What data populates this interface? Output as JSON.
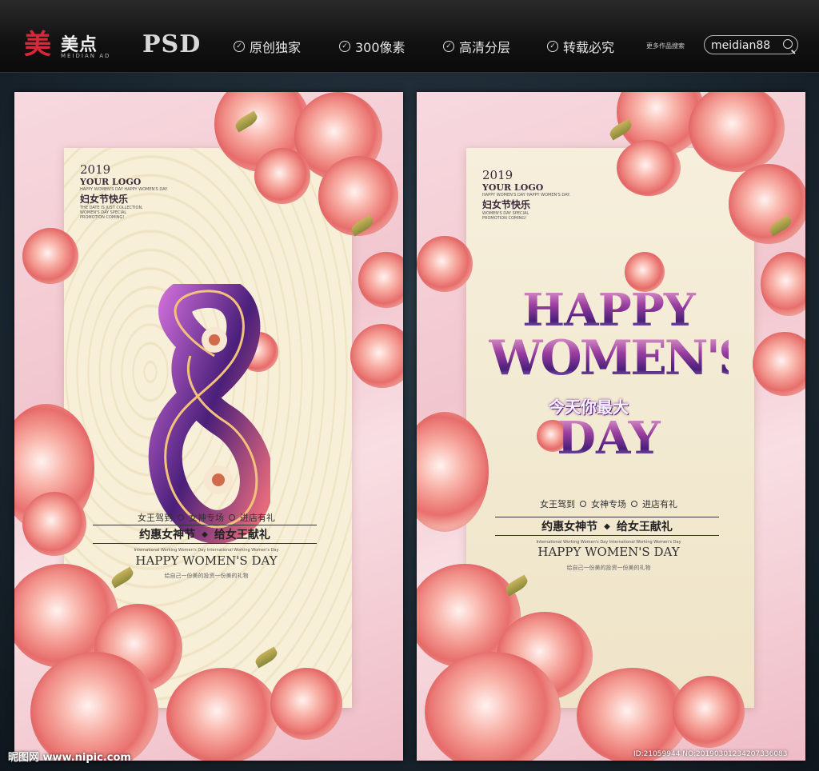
{
  "header": {
    "logo_mark": "美",
    "logo_text": "美点",
    "logo_sub": "MEIDIAN AD",
    "format": "PSD",
    "features": [
      "原创独家",
      "300像素",
      "高清分层",
      "转载必究"
    ],
    "more_label": "更多作品搜索",
    "search_value": "meidian88"
  },
  "poster_left": {
    "year": "2019",
    "logo": "YOUR LOGO",
    "tiny_en": "HAPPY WOMEN'S DAY HAPPY WOMEN'S DAY.",
    "title_cn": "妇女节快乐",
    "tiny_en2": "THE DATE IS JUST COLLECTION.",
    "tiny_promo": "WOMEN'S DAY SPECIAL PROMOTION COMING!",
    "events": [
      "女王驾到",
      "女神专场",
      "进店有礼"
    ],
    "tagline_a": "约惠女神节",
    "tagline_b": "给女王献礼",
    "small_en": "International Working Women's Day International Working Women's Day",
    "hwd": "HAPPY WOMEN'S DAY",
    "gift": "给自己一份美的投资一份美的礼物"
  },
  "poster_right": {
    "year": "2019",
    "logo": "YOUR LOGO",
    "tiny_en": "HAPPY WOMEN'S DAY HAPPY WOMEN'S DAY.",
    "title_cn": "妇女节快乐",
    "tiny_promo": "WOMEN'S DAY SPECIAL PROMOTION COMING!",
    "headline_1": "HAPPY",
    "headline_2": "WOMEN'S",
    "headline_cn": "今天你最大",
    "headline_3": "DAY",
    "events": [
      "女王驾到",
      "女神专场",
      "进店有礼"
    ],
    "tagline_a": "约惠女神节",
    "tagline_b": "给女王献礼",
    "small_en": "International Working Women's Day International Working Women's Day",
    "hwd": "HAPPY WOMEN'S DAY",
    "gift": "给自己一份美的投资一份美的礼物"
  },
  "footer": {
    "watermark": "昵图网 www.nipic.com",
    "id_text": "ID:21059944 NO:20190301234207336083"
  },
  "colors": {
    "brand_red": "#d6283a",
    "poster_pink": "#f2c6cf",
    "purple": "#5b1f7d"
  }
}
